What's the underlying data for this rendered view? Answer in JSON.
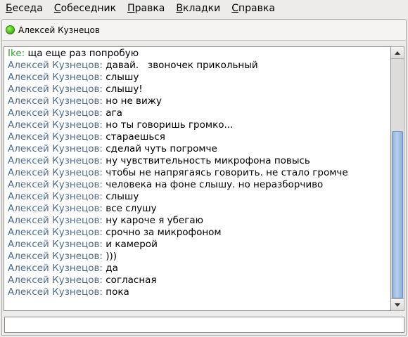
{
  "menubar": {
    "items": [
      {
        "mnemonic": "Б",
        "rest": "еседа"
      },
      {
        "mnemonic": "С",
        "rest": "обеседник"
      },
      {
        "mnemonic": "П",
        "rest": "равка"
      },
      {
        "mnemonic": "В",
        "rest": "кладки"
      },
      {
        "mnemonic": "С",
        "rest": "правка"
      }
    ]
  },
  "tab": {
    "label": "Алексей Кузнецов",
    "status_color": "#4fc31a"
  },
  "colors": {
    "contact_nick": "#4e6d8c",
    "self_nick": "#3b9a3b"
  },
  "chat": {
    "messages": [
      {
        "nick": "Ike:",
        "text": " ща еще раз попробую",
        "self": true
      },
      {
        "nick": "Алексей Кузнецов:",
        "text": " давай.   звоночек прикольный",
        "self": false
      },
      {
        "nick": "Алексей Кузнецов:",
        "text": " слышу",
        "self": false
      },
      {
        "nick": "Алексей Кузнецов:",
        "text": " слышу!",
        "self": false
      },
      {
        "nick": "Алексей Кузнецов:",
        "text": " но не вижу",
        "self": false
      },
      {
        "nick": "Алексей Кузнецов:",
        "text": " ага",
        "self": false
      },
      {
        "nick": "Алексей Кузнецов:",
        "text": " но ты говоришь громко...",
        "self": false
      },
      {
        "nick": "Алексей Кузнецов:",
        "text": " стараешься",
        "self": false
      },
      {
        "nick": "Алексей Кузнецов:",
        "text": " сделай чуть погромче",
        "self": false
      },
      {
        "nick": "Алексей Кузнецов:",
        "text": " ну чувствительность микрофона повысь",
        "self": false
      },
      {
        "nick": "Алексей Кузнецов:",
        "text": " чтобы не напрягаясь говорить. не стало громче",
        "self": false
      },
      {
        "nick": "Алексей Кузнецов:",
        "text": " человека на фоне слышу. но неразборчиво",
        "self": false
      },
      {
        "nick": "Алексей Кузнецов:",
        "text": " слышу",
        "self": false
      },
      {
        "nick": "Алексей Кузнецов:",
        "text": " все слушу",
        "self": false
      },
      {
        "nick": "Алексей Кузнецов:",
        "text": " ну кароче я убегаю",
        "self": false
      },
      {
        "nick": "Алексей Кузнецов:",
        "text": " срочно за микрофоном",
        "self": false
      },
      {
        "nick": "Алексей Кузнецов:",
        "text": " и камерой",
        "self": false
      },
      {
        "nick": "Алексей Кузнецов:",
        "text": " )))",
        "self": false
      },
      {
        "nick": "Алексей Кузнецов:",
        "text": " да",
        "self": false
      },
      {
        "nick": "Алексей Кузнецов:",
        "text": " согласная",
        "self": false
      },
      {
        "nick": "Алексей Кузнецов:",
        "text": " пока",
        "self": false
      }
    ]
  },
  "compose": {
    "value": "",
    "placeholder": ""
  },
  "scrollbar": {
    "up_icon": "arrow-up-icon",
    "down_icon": "arrow-down-icon"
  }
}
